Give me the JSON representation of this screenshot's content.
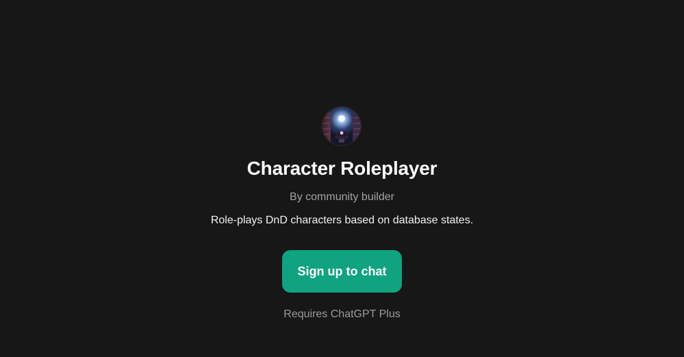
{
  "gpt": {
    "title": "Character Roleplayer",
    "byline": "By community builder",
    "description": "Role-plays DnD characters based on database states."
  },
  "cta": {
    "label": "Sign up to chat"
  },
  "requirement": "Requires ChatGPT Plus",
  "colors": {
    "background": "#171717",
    "accent": "#10a37f"
  },
  "icons": {
    "avatar": "gpt-avatar-image"
  }
}
